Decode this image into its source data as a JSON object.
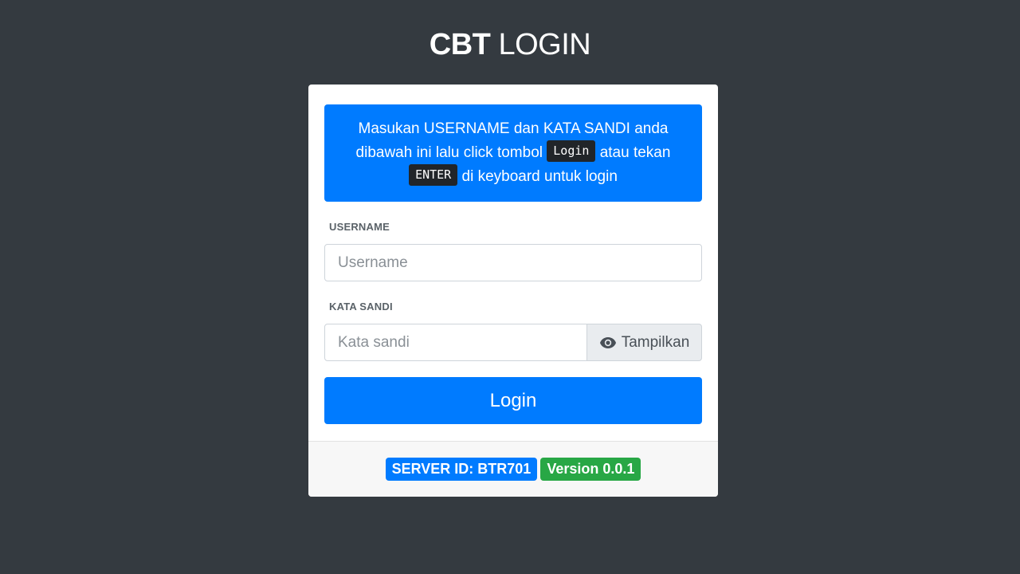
{
  "header": {
    "title_bold": "CBT",
    "title_light": "LOGIN"
  },
  "info": {
    "line1": "Masukan USERNAME dan KATA SANDI anda",
    "line2_prefix": "dibawah ini lalu click tombol",
    "key_login": "Login",
    "line2_suffix": "atau tekan",
    "key_enter": "ENTER",
    "line3_suffix": "di keyboard untuk login"
  },
  "form": {
    "username_label": "USERNAME",
    "username_placeholder": "Username",
    "username_value": "",
    "password_label": "KATA SANDI",
    "password_placeholder": "Kata sandi",
    "password_value": "",
    "toggle_label": "Tampilkan",
    "toggle_icon": "eye-icon",
    "login_label": "Login"
  },
  "footer": {
    "server_badge": "SERVER ID: BTR701",
    "version_badge": "Version 0.0.1"
  },
  "colors": {
    "background": "#343a40",
    "primary": "#007bff",
    "success": "#28a745",
    "dark_key": "#212529"
  }
}
